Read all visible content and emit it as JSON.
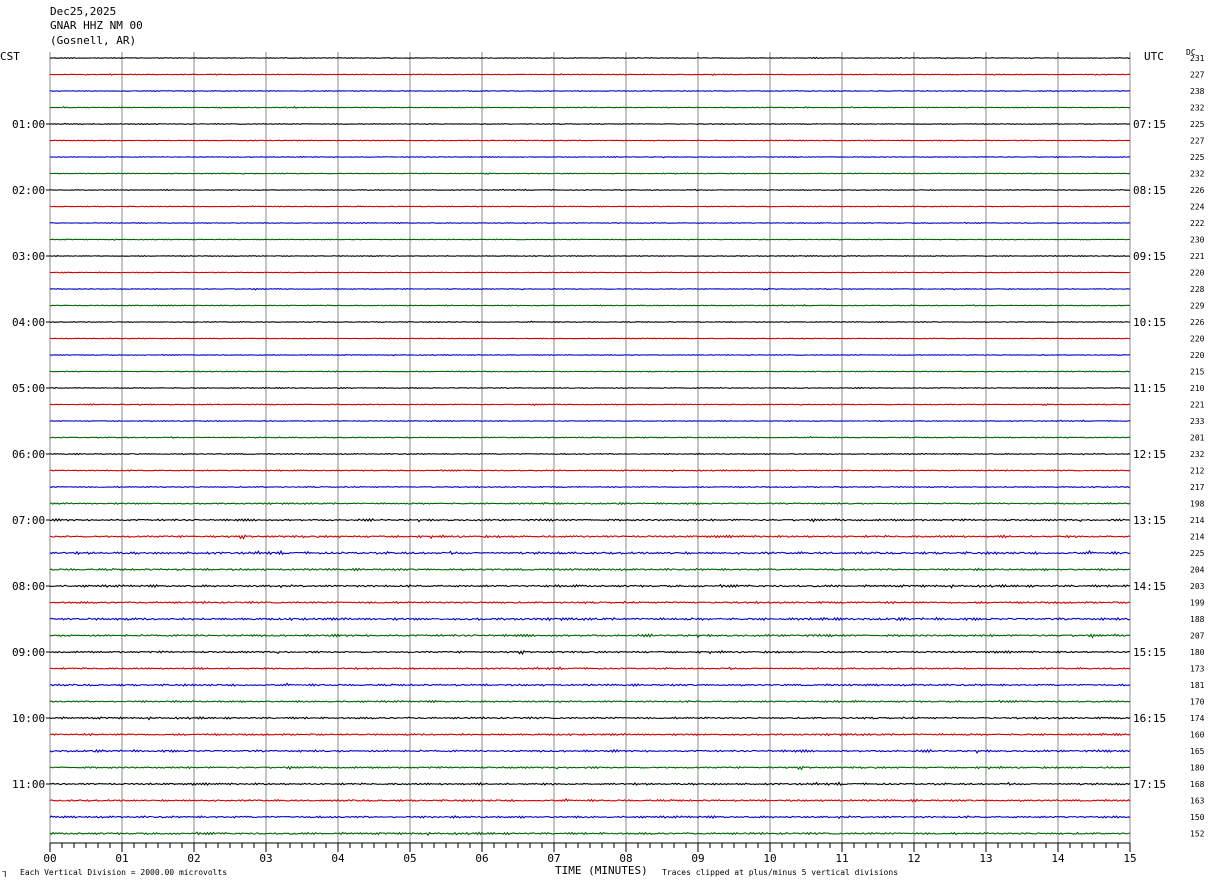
{
  "header": {
    "date": "Dec25,2025",
    "station": "GNAR HHZ NM 00",
    "location": "(Gosnell, AR)",
    "left_tz": "CST",
    "right_tz": "UTC",
    "dc_label": "DC"
  },
  "footer": {
    "scale_note": "Each Vertical Division = 2000.00 microvolts",
    "clip_note": "Traces clipped at plus/minus 5 vertical divisions",
    "mark": "⅂"
  },
  "chart_data": {
    "type": "line",
    "xlabel": "TIME (MINUTES)",
    "xlim": [
      0,
      15
    ],
    "x_ticks": [
      "00",
      "01",
      "02",
      "03",
      "04",
      "05",
      "06",
      "07",
      "08",
      "09",
      "10",
      "11",
      "12",
      "13",
      "14",
      "15"
    ],
    "left_hour_labels": [
      "01:00",
      "02:00",
      "03:00",
      "04:00",
      "05:00",
      "06:00",
      "07:00",
      "08:00",
      "09:00",
      "10:00",
      "11:00"
    ],
    "right_hour_labels": [
      "07:15",
      "08:15",
      "09:15",
      "10:15",
      "11:15",
      "12:15",
      "13:15",
      "14:15",
      "15:15",
      "16:15",
      "17:15"
    ],
    "trace_colors": [
      "#000000",
      "#d00000",
      "#0000c8",
      "#006400"
    ],
    "dc_offsets": [
      231,
      227,
      238,
      232,
      225,
      227,
      225,
      232,
      226,
      224,
      222,
      230,
      221,
      220,
      228,
      229,
      226,
      220,
      220,
      215,
      210,
      221,
      233,
      201,
      232,
      212,
      217,
      198,
      214,
      214,
      225,
      204,
      203,
      199,
      188,
      207,
      180,
      173,
      181,
      170,
      174,
      160,
      165,
      180,
      168,
      163,
      150,
      152
    ],
    "noise_levels": [
      0.4,
      0.35,
      0.4,
      0.35,
      0.4,
      0.35,
      0.35,
      0.35,
      0.4,
      0.35,
      0.4,
      0.35,
      0.4,
      0.35,
      0.4,
      0.4,
      0.4,
      0.35,
      0.35,
      0.4,
      0.45,
      0.4,
      0.4,
      0.45,
      0.5,
      0.5,
      0.55,
      0.65,
      0.8,
      0.9,
      1.0,
      0.85,
      0.9,
      0.85,
      1.0,
      0.9,
      0.8,
      0.7,
      0.8,
      0.75,
      0.8,
      0.8,
      0.85,
      0.75,
      0.8,
      0.8,
      0.85,
      0.9
    ]
  }
}
